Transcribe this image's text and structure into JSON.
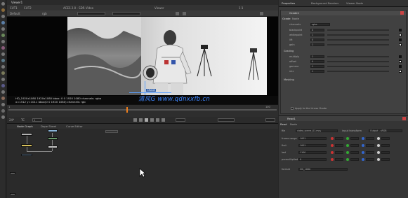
{
  "viewer": {
    "tab_label": "Viewer1",
    "input_a": "CUT1",
    "input_b": "CUT2",
    "colorspace": "ACES 2.0 - SDR Video",
    "channel": "Default",
    "channel_b": "rgb",
    "overlay": "Viewer",
    "zoom": "1:1",
    "info_line_1": "HD_1920x1080 1920x1080 bbox: 0 0 1920 1080 channels: rgba",
    "info_line_2": "x=1512 y=1011 bbox(0 0 1920 1080) channels: rgb",
    "frame_label": "33",
    "overlay_label": "GRADE"
  },
  "timeline": {
    "fps_label": "24*",
    "tc_label": "TC",
    "frame_counter": "1",
    "end_frame": "100",
    "ticks": [
      "1",
      "10",
      "20",
      "30",
      "40",
      "50",
      "60",
      "70",
      "80",
      "90",
      "100"
    ]
  },
  "graph": {
    "tabs": [
      "Node Graph",
      "Dope Sheet",
      "Curve Editor"
    ],
    "node_labels": [
      "Read1",
      "Grade1",
      "Viewer1"
    ]
  },
  "properties": {
    "tabs": [
      "Properties",
      "Background Renders",
      "Viewer Node"
    ],
    "node_name": "Grade1",
    "sub_tabs": [
      "Grade",
      "Node"
    ],
    "channels_label": "channels",
    "channels_value": "rgba",
    "rows": [
      {
        "label": "blackpoint",
        "value": "0"
      },
      {
        "label": "whitepoint",
        "value": "1"
      },
      {
        "label": "lift",
        "value": "0"
      },
      {
        "label": "gain",
        "value": "1"
      },
      {
        "label": "multiply",
        "value": "1"
      },
      {
        "label": "offset",
        "value": "0"
      },
      {
        "label": "gamma",
        "value": "1"
      },
      {
        "label": "mix",
        "value": "1"
      }
    ],
    "section_1": "Grading",
    "section_2": "Masking",
    "footer_label": "Apply to the Linear Grade",
    "second_node": {
      "name": "Read1",
      "tabs": [
        "Read",
        "Node"
      ],
      "file_label": "file",
      "file_value": "video_scene_01.mov",
      "colorspace_label": "input transform",
      "colorspace_value": "Output - sRGB",
      "rows": [
        {
          "label": "frame range",
          "value": "1001"
        },
        {
          "label": "first",
          "value": "1001"
        },
        {
          "label": "last",
          "value": "1100"
        },
        {
          "label": "premultiplied",
          "value": "0"
        }
      ],
      "format_label": "format",
      "format_value": "HD_1080"
    }
  },
  "watermark": "清风G www.qdnxxfb.cn",
  "icons": [
    "viewer-icon",
    "play-icon",
    "stop-icon",
    "node-icon",
    "cursor-icon"
  ]
}
